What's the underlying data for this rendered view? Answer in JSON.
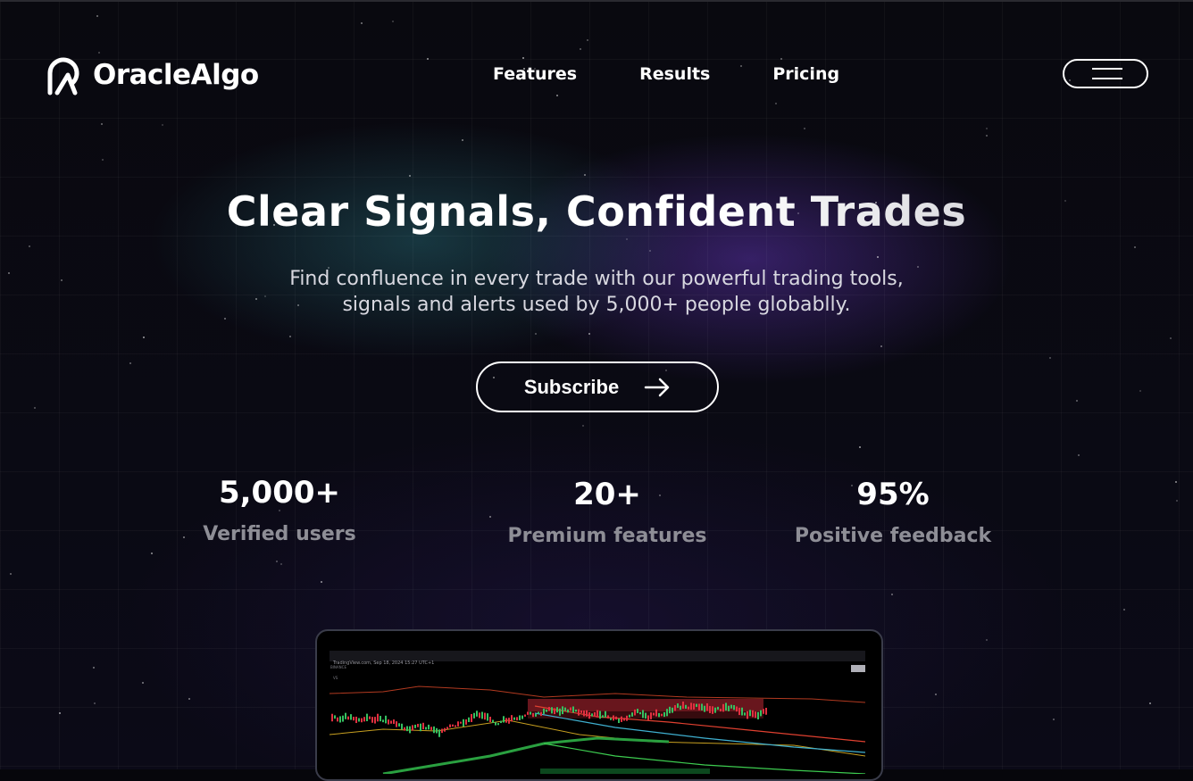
{
  "header": {
    "logo_text": "OracleAlgo",
    "logo_icon": "oraclealgo-logo-icon",
    "nav": [
      {
        "label": "Features"
      },
      {
        "label": "Results"
      },
      {
        "label": "Pricing"
      }
    ],
    "menu_icon": "hamburger-menu-icon"
  },
  "hero": {
    "title": "Clear Signals, Confident Trades",
    "subtitle_line1": "Find confluence in every trade with our powerful trading tools,",
    "subtitle_line2": "signals and alerts used by 5,000+ people globablly.",
    "cta_label": "Subscribe",
    "cta_icon": "arrow-right-icon"
  },
  "stats": [
    {
      "value": "5,000+",
      "caption": "Verified users"
    },
    {
      "value": "20+",
      "caption": "Premium features"
    },
    {
      "value": "95%",
      "caption": "Positive feedback"
    }
  ],
  "preview": {
    "chart_header": "TradingView.com, Sep 18, 2024 15:27 UTC+1",
    "exchange_label": "BINANCE",
    "volume_label": "VS"
  },
  "colors": {
    "background": "#06060b",
    "accent_teal": "#286e78",
    "accent_purple": "#5a32aa",
    "text_muted": "#8e8e96"
  }
}
